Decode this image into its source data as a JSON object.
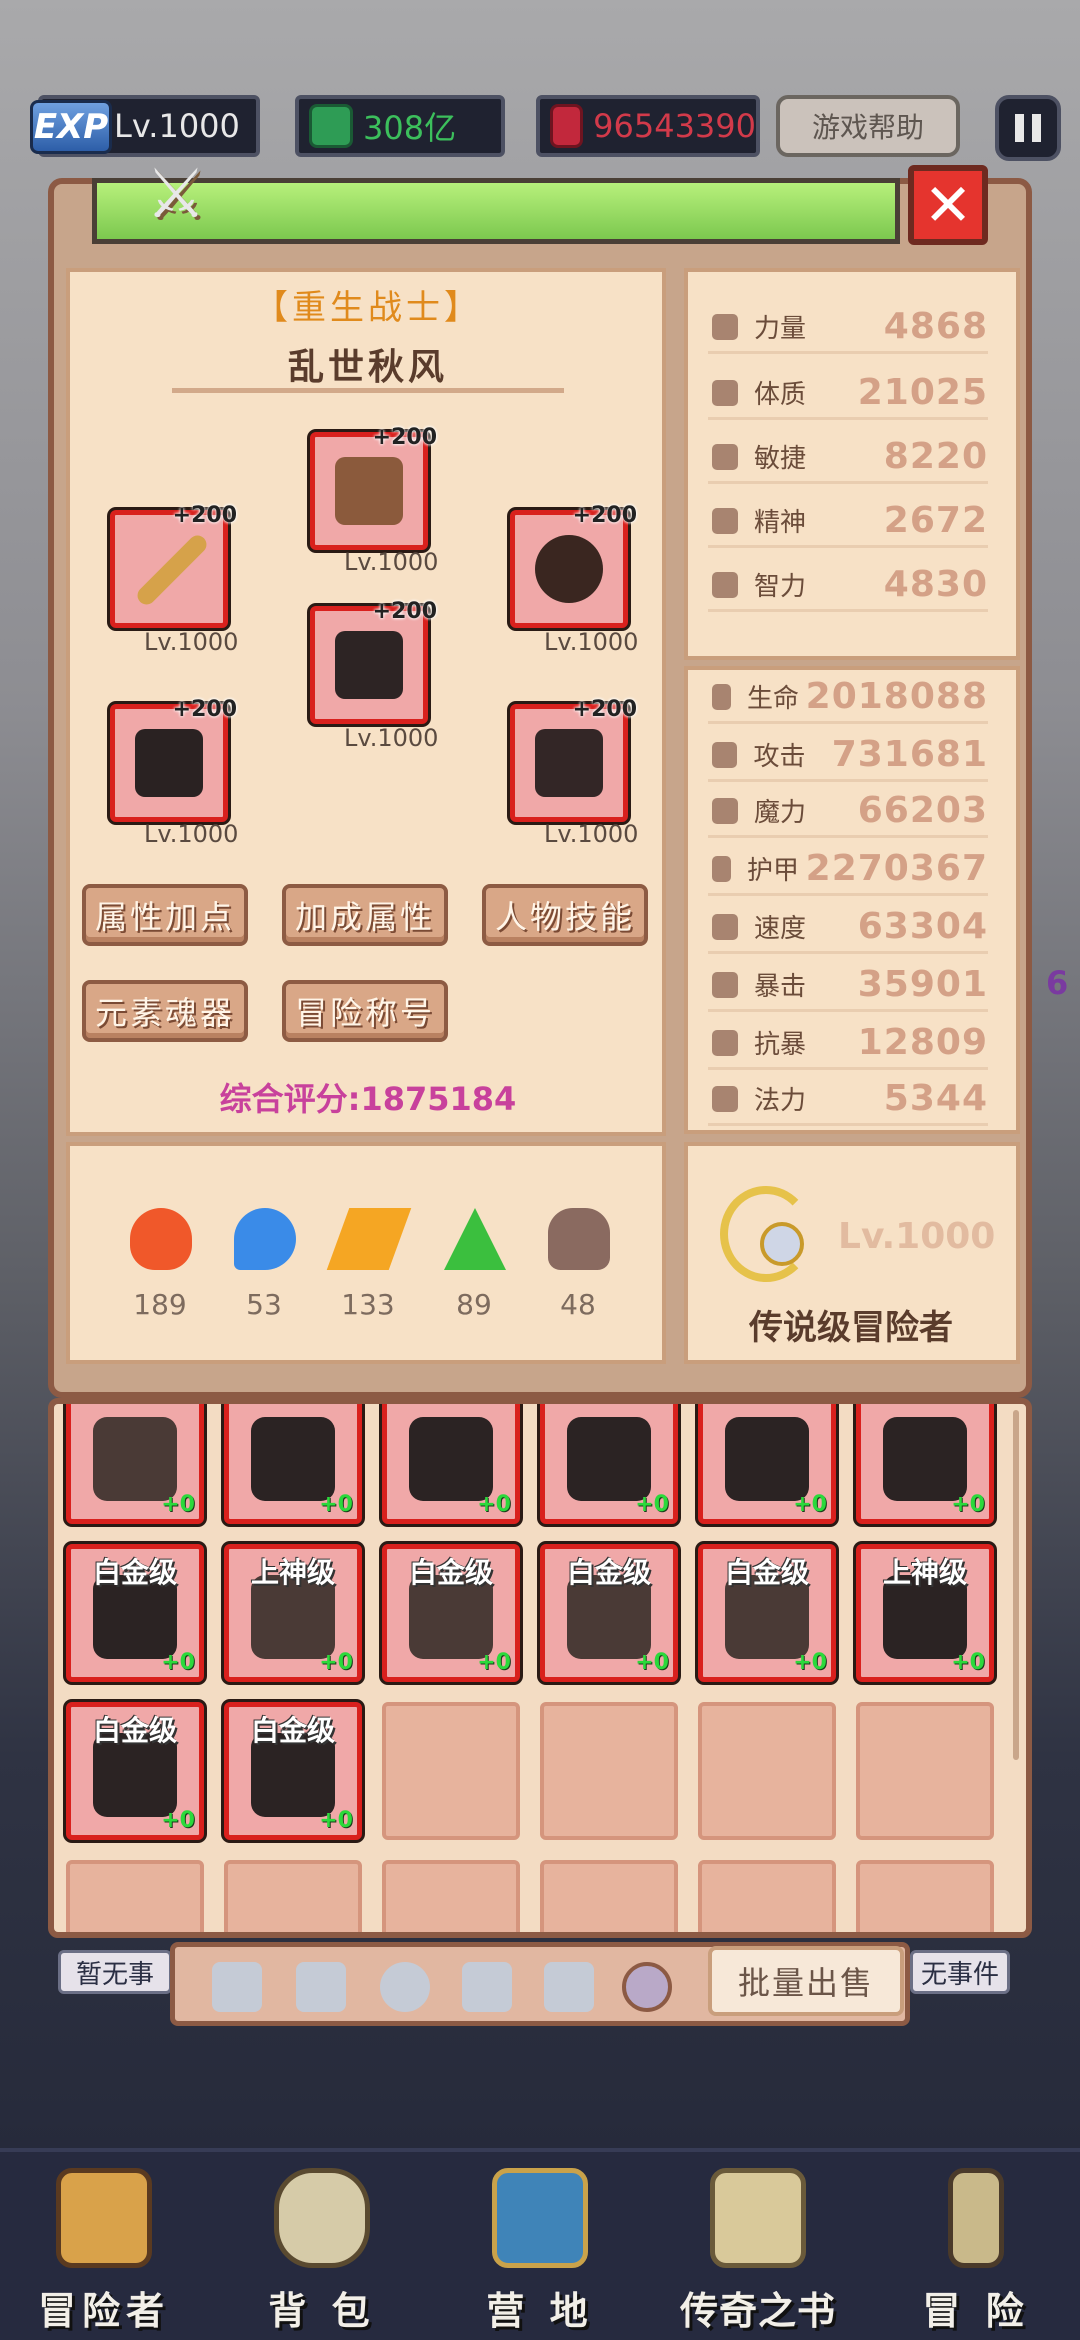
{
  "hud": {
    "exp_label": "EXP",
    "level": "Lv.1000",
    "green_currency": "308亿",
    "red_currency": "96543390",
    "help_button": "游戏帮助"
  },
  "character": {
    "class_name": "【重生战士】",
    "player_name": "乱世秋风",
    "equipment": [
      {
        "slot": "helmet",
        "plus": "+200",
        "level": "Lv.1000",
        "color": "#8b5a3c"
      },
      {
        "slot": "weapon",
        "plus": "+200",
        "level": "Lv.1000",
        "color": "#d6a24a"
      },
      {
        "slot": "accessory",
        "plus": "+200",
        "level": "Lv.1000",
        "color": "#3a2620"
      },
      {
        "slot": "armor",
        "plus": "+200",
        "level": "Lv.1000",
        "color": "#2d2424"
      },
      {
        "slot": "gloves",
        "plus": "+200",
        "level": "Lv.1000",
        "color": "#2a2222"
      },
      {
        "slot": "boots",
        "plus": "+200",
        "level": "Lv.1000",
        "color": "#332626"
      }
    ],
    "buttons": [
      "属性加点",
      "加成属性",
      "人物技能",
      "元素魂器",
      "冒险称号"
    ],
    "score": "综合评分:1875184",
    "elements": [
      {
        "name": "fire-icon",
        "value": "189",
        "color": "#f0582a"
      },
      {
        "name": "water-icon",
        "value": "53",
        "color": "#3a8be8"
      },
      {
        "name": "lightning-icon",
        "value": "133",
        "color": "#f5a623"
      },
      {
        "name": "nature-icon",
        "value": "89",
        "color": "#3bbf3e"
      },
      {
        "name": "dark-icon",
        "value": "48",
        "color": "#8a6a60"
      }
    ]
  },
  "base_stats": [
    {
      "label": "力量",
      "value": "4868"
    },
    {
      "label": "体质",
      "value": "21025"
    },
    {
      "label": "敏捷",
      "value": "8220"
    },
    {
      "label": "精神",
      "value": "2672"
    },
    {
      "label": "智力",
      "value": "4830"
    }
  ],
  "combat_stats": [
    {
      "label": "生命",
      "value": "2018088"
    },
    {
      "label": "攻击",
      "value": "731681"
    },
    {
      "label": "魔力",
      "value": "66203"
    },
    {
      "label": "护甲",
      "value": "2270367"
    },
    {
      "label": "速度",
      "value": "63304"
    },
    {
      "label": "暴击",
      "value": "35901"
    },
    {
      "label": "抗暴",
      "value": "12809"
    },
    {
      "label": "法力",
      "value": "5344"
    }
  ],
  "rank": {
    "level": "Lv.1000",
    "title": "传说级冒险者"
  },
  "inventory": {
    "row1": [
      {
        "tier": "",
        "plus": "+0",
        "item": "gloves"
      },
      {
        "tier": "",
        "plus": "+0",
        "item": "armor"
      },
      {
        "tier": "",
        "plus": "+0",
        "item": "armor"
      },
      {
        "tier": "",
        "plus": "+0",
        "item": "armor"
      },
      {
        "tier": "",
        "plus": "+0",
        "item": "armor"
      },
      {
        "tier": "",
        "plus": "+0",
        "item": "armor"
      }
    ],
    "row2": [
      {
        "tier": "白金级",
        "plus": "+0",
        "item": "armor"
      },
      {
        "tier": "上神级",
        "plus": "+0",
        "item": "gloves"
      },
      {
        "tier": "白金级",
        "plus": "+0",
        "item": "gloves"
      },
      {
        "tier": "白金级",
        "plus": "+0",
        "item": "gloves"
      },
      {
        "tier": "白金级",
        "plus": "+0",
        "item": "gloves"
      },
      {
        "tier": "上神级",
        "plus": "+0",
        "item": "armor"
      }
    ],
    "row3": [
      {
        "tier": "白金级",
        "plus": "+0",
        "item": "armor"
      },
      {
        "tier": "白金级",
        "plus": "+0",
        "item": "armor"
      }
    ]
  },
  "tabs": [
    "weapon-tab-icon",
    "shield-tab-icon",
    "helmet-tab-icon",
    "armor-tab-icon",
    "boots-tab-icon",
    "ring-tab-icon"
  ],
  "bulk_sell": "批量出售",
  "no_event_left": "暂无事",
  "no_event_right": "无事件",
  "side_number": "6",
  "nav": [
    "冒险者",
    "背 包",
    "营 地",
    "传奇之书",
    "冒 险"
  ]
}
